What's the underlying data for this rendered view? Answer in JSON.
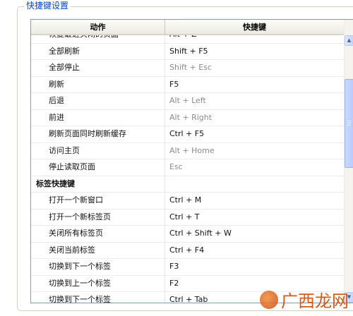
{
  "group_title": "快捷键设置",
  "table": {
    "columns": [
      "动作",
      "快捷键"
    ],
    "rows": [
      {
        "action": "恢复最近关闭的页面",
        "key": "Alt + Z",
        "disabled": false
      },
      {
        "action": "全部刷新",
        "key": "Shift + F5",
        "disabled": false
      },
      {
        "action": "全部停止",
        "key": "Shift + Esc",
        "disabled": true
      },
      {
        "action": "刷新",
        "key": "F5",
        "disabled": false
      },
      {
        "action": "后退",
        "key": "Alt + Left",
        "disabled": true
      },
      {
        "action": "前进",
        "key": "Alt + Right",
        "disabled": true
      },
      {
        "action": "刷新页面同时刷新缓存",
        "key": "Ctrl + F5",
        "disabled": false
      },
      {
        "action": "访问主页",
        "key": "Alt + Home",
        "disabled": true
      },
      {
        "action": "停止读取页面",
        "key": "Esc",
        "disabled": true
      },
      {
        "action": "标签快捷键",
        "key": "",
        "group": true
      },
      {
        "action": "打开一个新窗口",
        "key": "Ctrl + M",
        "disabled": false
      },
      {
        "action": "打开一个新标签页",
        "key": "Ctrl + T",
        "disabled": false
      },
      {
        "action": "关闭所有标签页",
        "key": "Ctrl + Shift + W",
        "disabled": false
      },
      {
        "action": "关闭当前标签",
        "key": "Ctrl + F4",
        "disabled": false
      },
      {
        "action": "切换到下一个标签",
        "key": "F3",
        "disabled": false
      },
      {
        "action": "切换到上一个标签",
        "key": "F2",
        "disabled": false
      },
      {
        "action": "切换到下一个标签",
        "key": "Ctrl + Tab",
        "disabled": false
      }
    ]
  },
  "watermark": "广西龙网",
  "colors": {
    "legend": "#0046d5",
    "disabled_text": "#8a8a8a",
    "watermark": "#d55a17"
  }
}
